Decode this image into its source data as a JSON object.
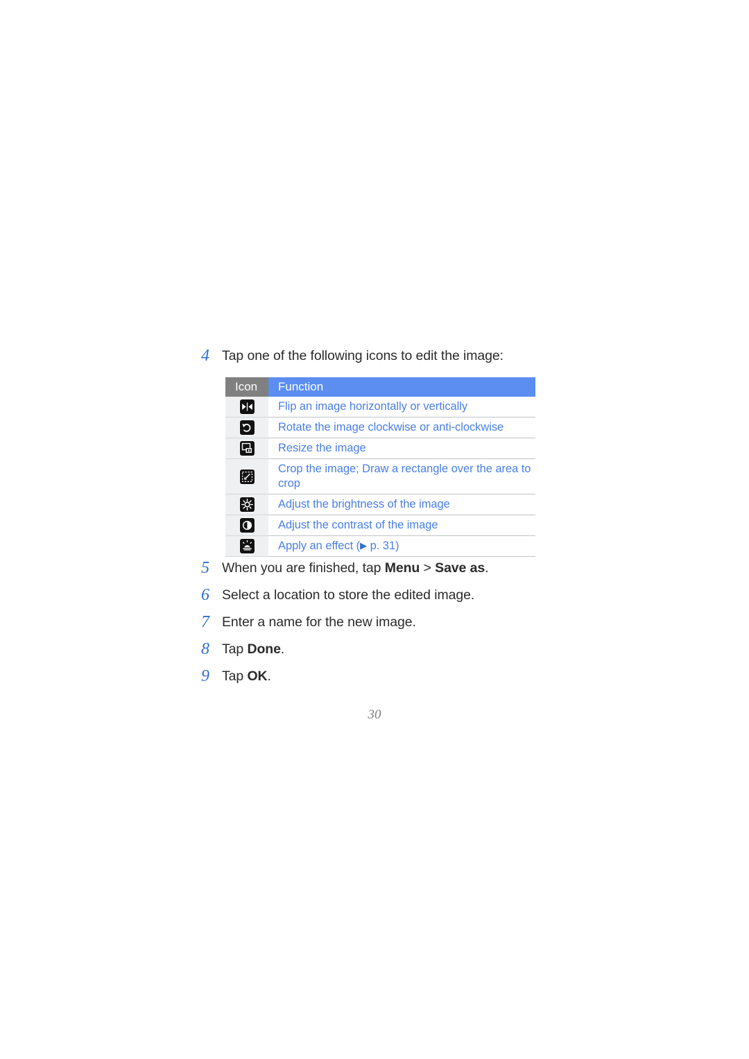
{
  "document": {
    "page_number": "30"
  },
  "intro_step": {
    "number": "4",
    "text": "Tap one of the following icons to edit the image:"
  },
  "table": {
    "headers": {
      "icon": "Icon",
      "function": "Function"
    },
    "colors": {
      "header_icon_bg": "#808080",
      "header_function_bg": "#5b8ef0",
      "body_text": "#4a7fe8",
      "icon_cell_bg": "#eff0f1",
      "icon_glyph_bg": "#121212"
    },
    "rows": [
      {
        "icon": "flip-icon",
        "function": "Flip an image horizontally or vertically"
      },
      {
        "icon": "rotate-icon",
        "function": "Rotate the image clockwise or anti-clockwise"
      },
      {
        "icon": "resize-icon",
        "function": "Resize the image"
      },
      {
        "icon": "crop-icon",
        "function": "Crop the image; Draw a rectangle over the area to crop"
      },
      {
        "icon": "brightness-icon",
        "function": "Adjust the brightness of the image"
      },
      {
        "icon": "contrast-icon",
        "function": "Adjust the contrast of the image"
      },
      {
        "icon": "effect-icon",
        "function_prefix": "Apply an effect (",
        "function_ref": "p. 31",
        "function_suffix": ")"
      }
    ]
  },
  "steps": [
    {
      "number": "5",
      "parts": [
        {
          "text": "When you are finished, tap ",
          "bold": false
        },
        {
          "text": "Menu",
          "bold": true
        },
        {
          "text": " > ",
          "bold": false
        },
        {
          "text": "Save as",
          "bold": true
        },
        {
          "text": ".",
          "bold": false
        }
      ]
    },
    {
      "number": "6",
      "parts": [
        {
          "text": "Select a location to store the edited image.",
          "bold": false
        }
      ]
    },
    {
      "number": "7",
      "parts": [
        {
          "text": "Enter a name for the new image.",
          "bold": false
        }
      ]
    },
    {
      "number": "8",
      "parts": [
        {
          "text": "Tap ",
          "bold": false
        },
        {
          "text": "Done",
          "bold": true
        },
        {
          "text": ".",
          "bold": false
        }
      ]
    },
    {
      "number": "9",
      "parts": [
        {
          "text": "Tap ",
          "bold": false
        },
        {
          "text": "OK",
          "bold": true
        },
        {
          "text": ".",
          "bold": false
        }
      ]
    }
  ]
}
